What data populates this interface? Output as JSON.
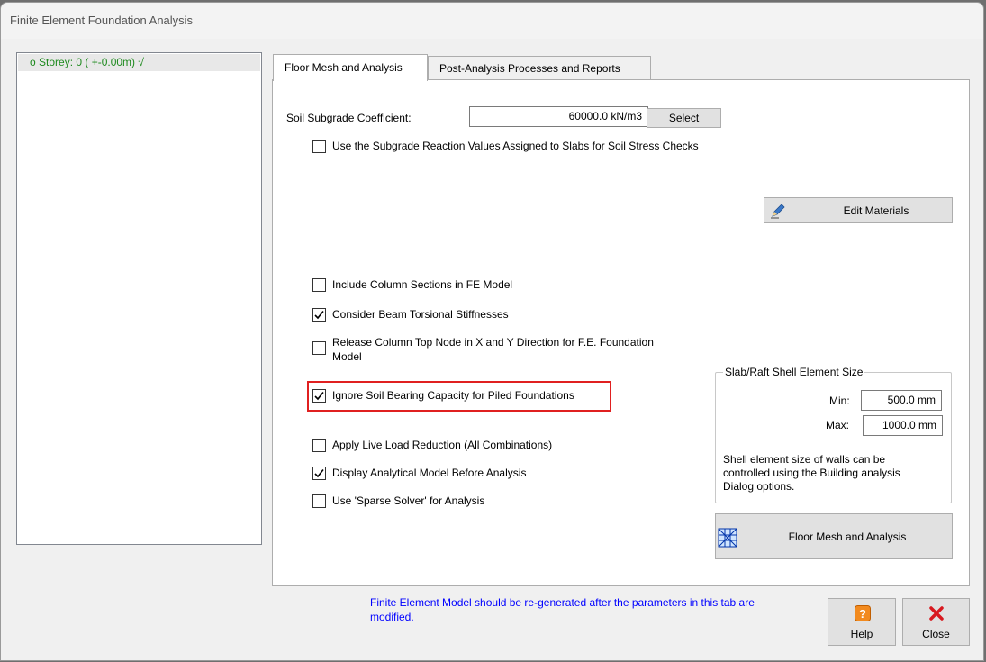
{
  "window": {
    "title": "Finite Element Foundation Analysis"
  },
  "tree": {
    "items": [
      {
        "label": "o  Storey: 0 ( +-0.00m) √"
      }
    ]
  },
  "tabs": [
    {
      "label": "Floor Mesh and Analysis",
      "active": true
    },
    {
      "label": "Post-Analysis Processes and Reports",
      "active": false
    }
  ],
  "soil": {
    "label": "Soil Subgrade Coefficient:",
    "value": "60000.0 kN/m3",
    "select_label": "Select"
  },
  "checkboxes": {
    "subgrade": {
      "label": "Use the Subgrade Reaction Values Assigned to Slabs for Soil Stress Checks",
      "checked": false
    },
    "column_sections": {
      "label": "Include Column Sections in FE Model",
      "checked": false
    },
    "beam_torsional": {
      "label": "Consider Beam Torsional Stiffnesses",
      "checked": true
    },
    "release_column": {
      "label_line1": "Release Column Top Node in X and Y Direction for F.E. Foundation",
      "label_line2": "Model",
      "checked": false
    },
    "ignore_soil": {
      "label": "Ignore Soil Bearing Capacity for Piled Foundations",
      "checked": true
    },
    "live_load": {
      "label": "Apply Live Load Reduction (All Combinations)",
      "checked": false
    },
    "display_model": {
      "label": "Display Analytical Model Before Analysis",
      "checked": true
    },
    "sparse_solver": {
      "label": "Use 'Sparse Solver' for Analysis",
      "checked": false
    }
  },
  "edit_materials": {
    "label": "Edit Materials",
    "icon": "pencil-icon"
  },
  "shell_size": {
    "title": "Slab/Raft Shell Element Size",
    "min_label": "Min:",
    "min_value": "500.0 mm",
    "max_label": "Max:",
    "max_value": "1000.0 mm",
    "note_line1": "Shell element size of walls can be",
    "note_line2": "controlled using the Building analysis",
    "note_line3": "Dialog options."
  },
  "mesh_button": {
    "label": "Floor Mesh and Analysis",
    "icon": "mesh-icon"
  },
  "footer": {
    "note_line1": "Finite Element Model should be re-generated after the parameters in this tab are",
    "note_line2": "modified.",
    "note_color": "#0000ff",
    "help_label": "Help",
    "close_label": "Close"
  },
  "colors": {
    "highlight": "#e02020",
    "tree_text": "#1e8a1e"
  }
}
